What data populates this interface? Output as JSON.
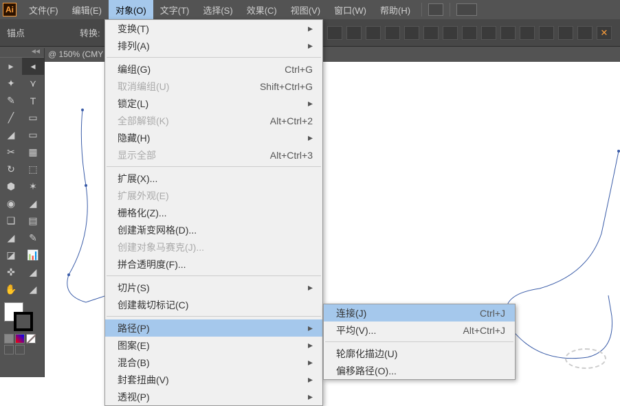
{
  "menubar": {
    "items": [
      "文件(F)",
      "编辑(E)",
      "对象(O)",
      "文字(T)",
      "选择(S)",
      "效果(C)",
      "视图(V)",
      "窗口(W)",
      "帮助(H)"
    ],
    "active_index": 2
  },
  "optionbar": {
    "anchor_label": "锚点",
    "convert_label": "转换:"
  },
  "tab": {
    "zoom": "@ 150% (CMY"
  },
  "menu_main": [
    {
      "label": "变换(T)",
      "arrow": true
    },
    {
      "label": "排列(A)",
      "arrow": true
    },
    {
      "sep": true
    },
    {
      "label": "编组(G)",
      "shortcut": "Ctrl+G"
    },
    {
      "label": "取消编组(U)",
      "shortcut": "Shift+Ctrl+G",
      "disabled": true
    },
    {
      "label": "锁定(L)",
      "arrow": true
    },
    {
      "label": "全部解锁(K)",
      "shortcut": "Alt+Ctrl+2",
      "disabled": true
    },
    {
      "label": "隐藏(H)",
      "arrow": true
    },
    {
      "label": "显示全部",
      "shortcut": "Alt+Ctrl+3",
      "disabled": true
    },
    {
      "sep": true
    },
    {
      "label": "扩展(X)..."
    },
    {
      "label": "扩展外观(E)",
      "disabled": true
    },
    {
      "label": "栅格化(Z)..."
    },
    {
      "label": "创建渐变网格(D)..."
    },
    {
      "label": "创建对象马赛克(J)...",
      "disabled": true
    },
    {
      "label": "拼合透明度(F)..."
    },
    {
      "sep": true
    },
    {
      "label": "切片(S)",
      "arrow": true
    },
    {
      "label": "创建裁切标记(C)"
    },
    {
      "sep": true
    },
    {
      "label": "路径(P)",
      "arrow": true,
      "highlight": true
    },
    {
      "label": "图案(E)",
      "arrow": true
    },
    {
      "label": "混合(B)",
      "arrow": true
    },
    {
      "label": "封套扭曲(V)",
      "arrow": true
    },
    {
      "label": "透视(P)",
      "arrow": true
    }
  ],
  "menu_sub": [
    {
      "label": "连接(J)",
      "shortcut": "Ctrl+J",
      "highlight": true
    },
    {
      "label": "平均(V)...",
      "shortcut": "Alt+Ctrl+J"
    },
    {
      "sep": true
    },
    {
      "label": "轮廓化描边(U)"
    },
    {
      "label": "偏移路径(O)..."
    }
  ],
  "tools": [
    "▸",
    "◂",
    "✦",
    "⋎",
    "✎",
    "T",
    "╱",
    "▭",
    "◢",
    "▭",
    "✂",
    "▦",
    "↻",
    "⬚",
    "⬢",
    "✶",
    "◉",
    "◢",
    "❑",
    "▤",
    "◢",
    "✎",
    "◪",
    "📊",
    "✜",
    "◢",
    "✋",
    "◢"
  ],
  "logo": "Ai"
}
